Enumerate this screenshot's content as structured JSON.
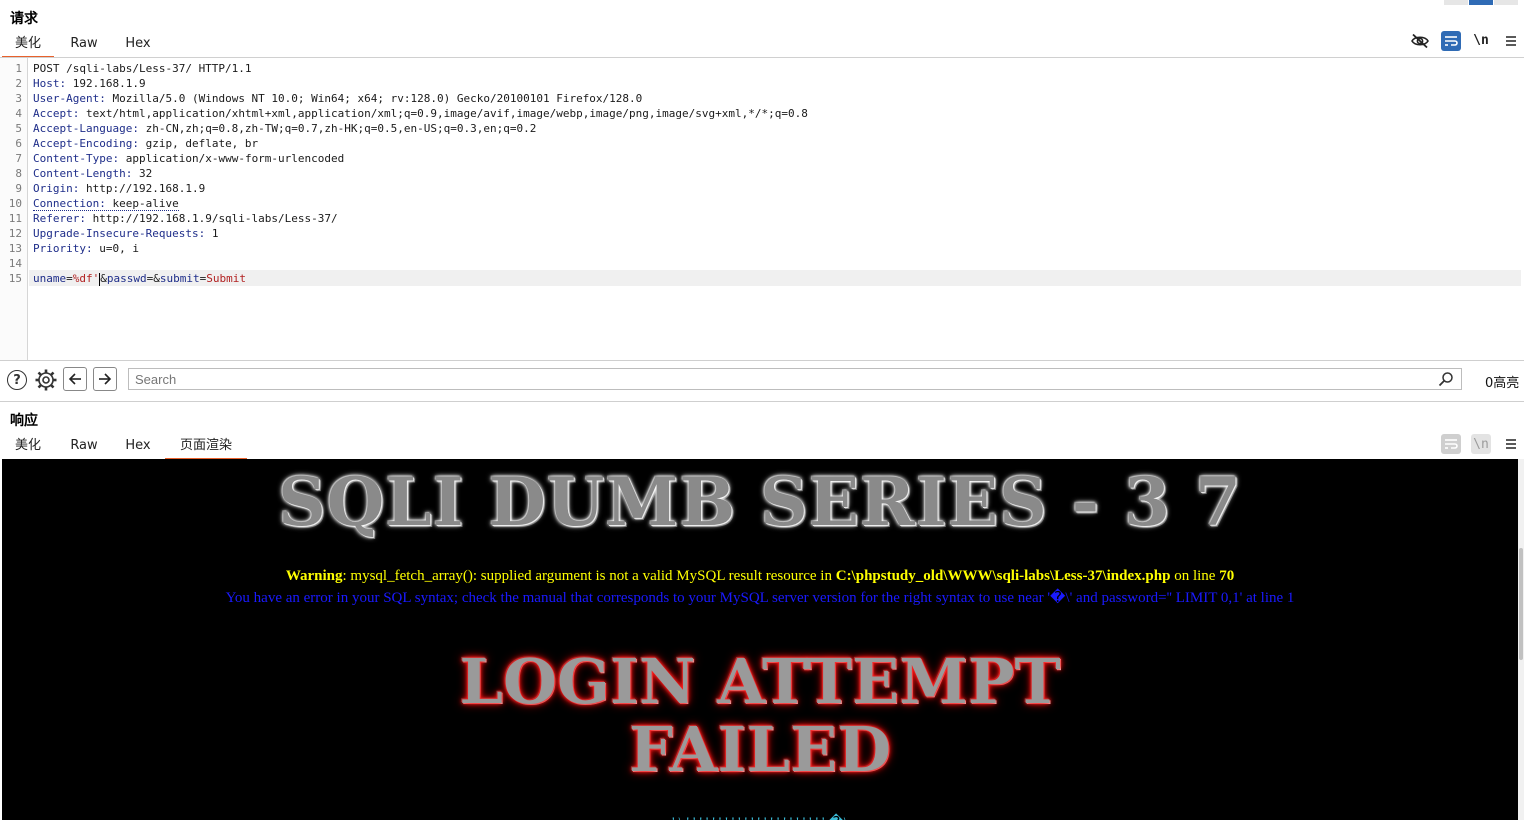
{
  "request": {
    "title": "请求",
    "tabs": [
      "美化",
      "Raw",
      "Hex"
    ],
    "active_tab": "美化",
    "toolbar": {
      "newline_label": "\\n"
    },
    "lines": [
      {
        "n": "1",
        "text": "POST /sqli-labs/Less-37/ HTTP/1.1"
      },
      {
        "n": "2",
        "key": "Host",
        "value": "192.168.1.9"
      },
      {
        "n": "3",
        "key": "User-Agent",
        "value": "Mozilla/5.0 (Windows NT 10.0; Win64; x64; rv:128.0) Gecko/20100101 Firefox/128.0"
      },
      {
        "n": "4",
        "key": "Accept",
        "value": "text/html,application/xhtml+xml,application/xml;q=0.9,image/avif,image/webp,image/png,image/svg+xml,*/*;q=0.8"
      },
      {
        "n": "5",
        "key": "Accept-Language",
        "value": "zh-CN,zh;q=0.8,zh-TW;q=0.7,zh-HK;q=0.5,en-US;q=0.3,en;q=0.2"
      },
      {
        "n": "6",
        "key": "Accept-Encoding",
        "value": "gzip, deflate, br"
      },
      {
        "n": "7",
        "key": "Content-Type",
        "value": "application/x-www-form-urlencoded"
      },
      {
        "n": "8",
        "key": "Content-Length",
        "value": "32"
      },
      {
        "n": "9",
        "key": "Origin",
        "value": "http://192.168.1.9"
      },
      {
        "n": "10",
        "key": "Connection",
        "value": "keep-alive"
      },
      {
        "n": "11",
        "key": "Referer",
        "value": "http://192.168.1.9/sqli-labs/Less-37/"
      },
      {
        "n": "12",
        "key": "Upgrade-Insecure-Requests",
        "value": "1"
      },
      {
        "n": "13",
        "key": "Priority",
        "value": "u=0, i"
      },
      {
        "n": "14",
        "text": ""
      },
      {
        "n": "15",
        "body": true
      }
    ],
    "body": {
      "p1_key": "uname",
      "eq": "=",
      "p1_val": "%df'",
      "amp": "&",
      "p2_key": "passwd",
      "p3_key": "submit",
      "p3_val": "Submit"
    }
  },
  "search": {
    "placeholder": "Search",
    "highlights": "0高亮"
  },
  "response": {
    "title": "响应",
    "tabs": [
      "美化",
      "Raw",
      "Hex",
      "页面渲染"
    ],
    "active_tab": "页面渲染",
    "render": {
      "title": "SQLI DUMB SERIES - 3 7",
      "warning_label": "Warning",
      "warning_text": ": mysql_fetch_array(): supplied argument is not a valid MySQL result resource in ",
      "warning_path": "C:\\phpstudy_old\\WWW\\sqli-labs\\Less-37\\index.php",
      "warning_on": " on line ",
      "warning_line": "70",
      "sql_error": "You have an error in your SQL syntax; check the manual that corresponds to your MySQL server version for the right syntax to use near '�\\' and password='' LIMIT 0,1' at line 1",
      "login_line1": "LOGIN ATTEMPT",
      "login_line2": "FAILED",
      "cut_text": "' \\ ' ' ' ' ' ' ' ' ' ' ' ' ' ' ' ' ' ' ' ' ' ' �\\"
    }
  },
  "colors": {
    "accent_tab": "#e8612c",
    "wrap_button": "#2f6bb5",
    "header_key": "#1f2e8a",
    "param_value": "#b22222",
    "warning_yellow": "#ffff00",
    "error_blue": "#1a1aff",
    "login_glow": "#ff1a1a"
  },
  "icons": [
    "eye-off-icon",
    "wrap-lines-icon",
    "newline-icon",
    "menu-icon",
    "help-icon",
    "gear-icon",
    "arrow-left-icon",
    "arrow-right-icon",
    "search-icon"
  ]
}
